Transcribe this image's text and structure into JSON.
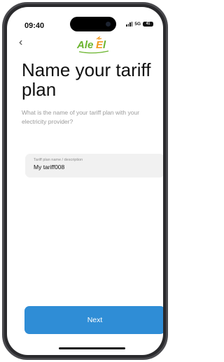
{
  "status_bar": {
    "time": "09:40",
    "network": "5G",
    "battery": "41"
  },
  "header": {
    "logo_text": "AleEl",
    "back_icon": "chevron-left-icon"
  },
  "main": {
    "title": "Name your tariff plan",
    "subtitle": "What is the name of your tariff plan with your electricity provider?",
    "field": {
      "label": "Tariff plan name / description",
      "value": "My tariff008"
    },
    "next_label": "Next"
  },
  "colors": {
    "accent": "#2f8dd6",
    "logo_green": "#6ab42d",
    "logo_orange": "#f29a1f"
  }
}
